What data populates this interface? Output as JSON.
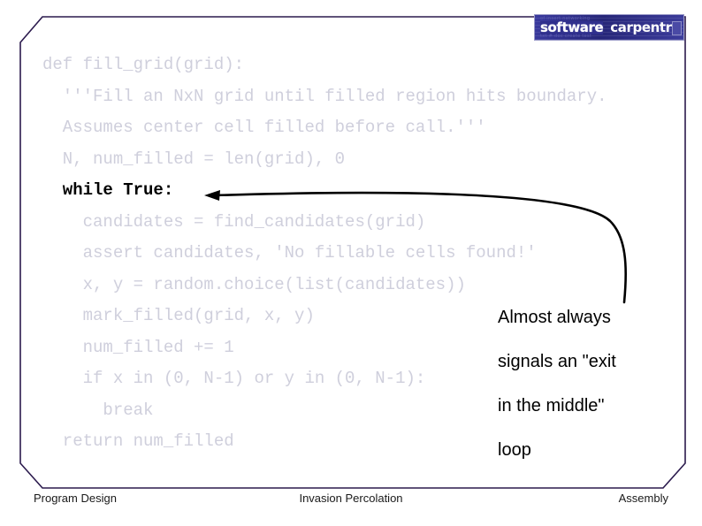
{
  "slide": {
    "logo": {
      "word_one": "software",
      "word_two": "carpentry",
      "faint_top": "of insert networking",
      "faint_bottom": "txt # doc create test"
    },
    "code": {
      "language": "python",
      "lines": [
        {
          "text": "def fill_grid(grid):",
          "emphasis": false
        },
        {
          "text": "  '''Fill an NxN grid until filled region hits boundary.",
          "emphasis": false
        },
        {
          "text": "  Assumes center cell filled before call.'''",
          "emphasis": false
        },
        {
          "text": "  N, num_filled = len(grid), 0",
          "emphasis": false
        },
        {
          "text": "  while True:",
          "emphasis": true
        },
        {
          "text": "    candidates = find_candidates(grid)",
          "emphasis": false
        },
        {
          "text": "    assert candidates, 'No fillable cells found!'",
          "emphasis": false
        },
        {
          "text": "    x, y = random.choice(list(candidates))",
          "emphasis": false
        },
        {
          "text": "    mark_filled(grid, x, y)",
          "emphasis": false
        },
        {
          "text": "    num_filled += 1",
          "emphasis": false
        },
        {
          "text": "    if x in (0, N-1) or y in (0, N-1):",
          "emphasis": false
        },
        {
          "text": "      break",
          "emphasis": false
        },
        {
          "text": "  return num_filled",
          "emphasis": false
        }
      ]
    },
    "annotation": {
      "lines": [
        "Almost always",
        "signals an \"exit",
        "in the middle\"",
        "loop"
      ]
    },
    "footer": {
      "left": "Program Design",
      "center": "Invasion Percolation",
      "right": "Assembly"
    },
    "colors": {
      "frame": "#2b1a4d",
      "code_dim": "#cfcfdc",
      "code_emphasis": "#000000",
      "annotation": "#000000",
      "logo_background": "#2b2b8f",
      "logo_text": "#ffffff"
    }
  }
}
